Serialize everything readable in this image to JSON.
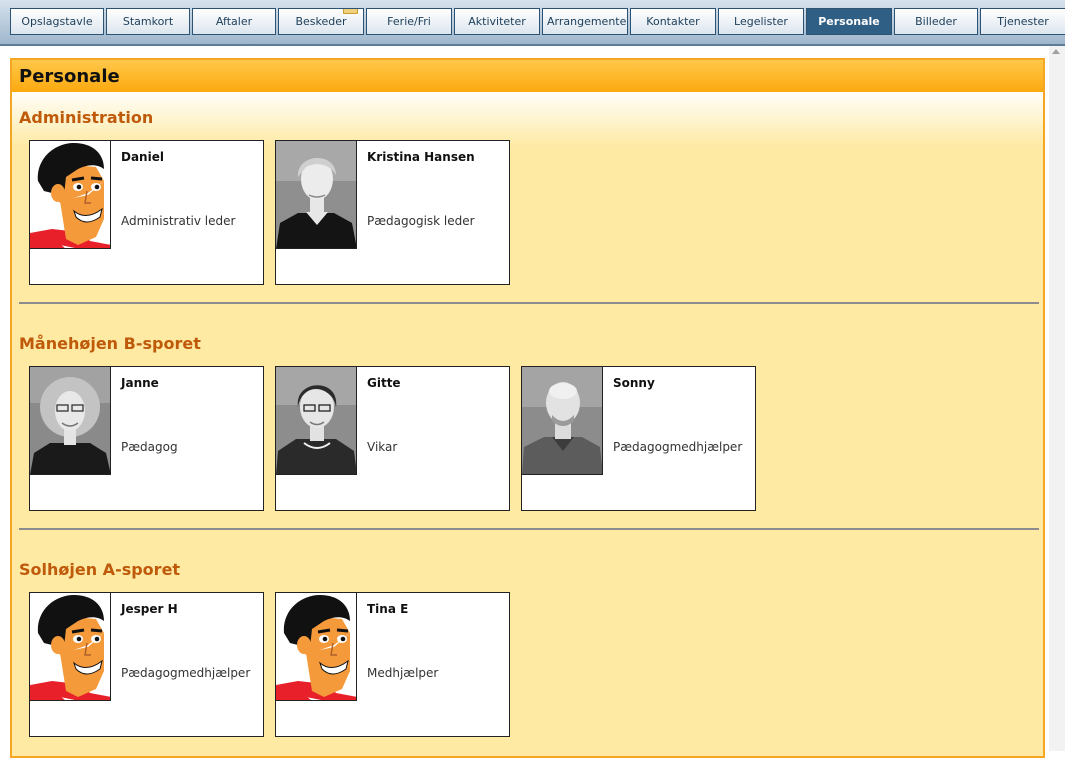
{
  "nav": {
    "tabs": [
      {
        "label": "Opslagstavle"
      },
      {
        "label": "Stamkort"
      },
      {
        "label": "Aftaler"
      },
      {
        "label": "Beskeder"
      },
      {
        "label": "Ferie/Fri"
      },
      {
        "label": "Aktiviteter"
      },
      {
        "label": "Arrangemente"
      },
      {
        "label": "Kontakter"
      },
      {
        "label": "Legelister"
      },
      {
        "label": "Personale"
      },
      {
        "label": "Billeder"
      },
      {
        "label": "Tjenester"
      }
    ],
    "active_tab": "Personale",
    "envelope_icon": "envelope-icon"
  },
  "page": {
    "title": "Personale"
  },
  "groups": [
    {
      "title": "Administration",
      "staff": [
        {
          "name": "Daniel",
          "role": "Administrativ leder",
          "avatar": "cartoon-avatar-icon"
        },
        {
          "name": "Kristina Hansen",
          "role": "Pædagogisk leder",
          "avatar": "photo-woman-short-blonde"
        }
      ]
    },
    {
      "title": "Månehøjen B-sporet",
      "staff": [
        {
          "name": "Janne",
          "role": "Pædagog",
          "avatar": "photo-woman-curly-glasses"
        },
        {
          "name": "Gitte",
          "role": "Vikar",
          "avatar": "photo-woman-dark-glasses"
        },
        {
          "name": "Sonny",
          "role": "Pædagogmedhjælper",
          "avatar": "photo-man-bald"
        }
      ]
    },
    {
      "title": "Solhøjen A-sporet",
      "staff": [
        {
          "name": "Jesper H",
          "role": "Pædagogmedhjælper",
          "avatar": "cartoon-avatar-icon"
        },
        {
          "name": "Tina E",
          "role": "Medhjælper",
          "avatar": "cartoon-avatar-icon"
        }
      ]
    }
  ],
  "colors": {
    "panel_bg": "#feeaa3",
    "header_orange": "#fca90f",
    "section_title": "#bf5a0a",
    "active_tab": "#2f5f85"
  }
}
